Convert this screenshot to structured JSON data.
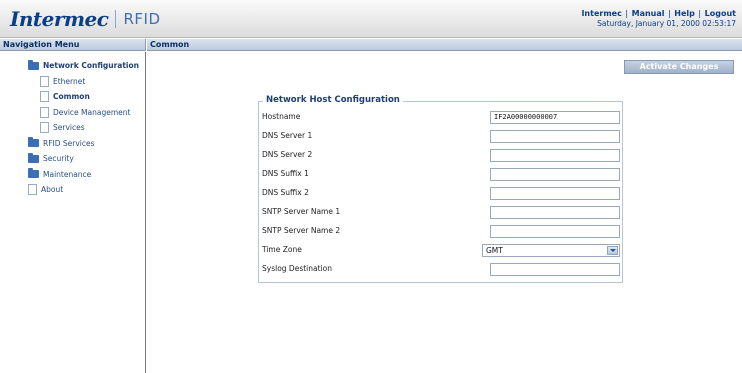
{
  "header": {
    "logo_text": "Intermec",
    "product": "RFID",
    "links": [
      "Intermec",
      "Manual",
      "Help",
      "Logout"
    ],
    "datetime": "Saturday, January 01, 2000 02:53:17"
  },
  "nav": {
    "title": "Navigation Menu",
    "items": [
      {
        "label": "Network Configuration",
        "type": "folder",
        "level": 1
      },
      {
        "label": "Ethernet",
        "type": "page",
        "level": 2
      },
      {
        "label": "Common",
        "type": "page",
        "level": 2
      },
      {
        "label": "Device Management",
        "type": "page",
        "level": 2
      },
      {
        "label": "Services",
        "type": "page",
        "level": 2
      },
      {
        "label": "RFID Services",
        "type": "folder",
        "level": 1
      },
      {
        "label": "Security",
        "type": "folder",
        "level": 1
      },
      {
        "label": "Maintenance",
        "type": "folder",
        "level": 1
      },
      {
        "label": "About",
        "type": "page",
        "level": 1
      }
    ]
  },
  "main": {
    "title": "Common",
    "activate_label": "Activate Changes",
    "fieldset_title": "Network Host Configuration",
    "fields": [
      {
        "label": "Hostname",
        "value": "IF2A00000000007"
      },
      {
        "label": "DNS Server 1",
        "value": ""
      },
      {
        "label": "DNS Server 2",
        "value": ""
      },
      {
        "label": "DNS Suffix 1",
        "value": ""
      },
      {
        "label": "DNS Suffix 2",
        "value": ""
      },
      {
        "label": "SNTP Server Name 1",
        "value": ""
      },
      {
        "label": "SNTP Server Name 2",
        "value": ""
      },
      {
        "label": "Time Zone",
        "value": "GMT"
      },
      {
        "label": "Syslog Destination",
        "value": ""
      }
    ]
  },
  "colors": {
    "brand": "#0b3e87",
    "folder": "#3b6fb4",
    "bar": "#bccadb"
  }
}
